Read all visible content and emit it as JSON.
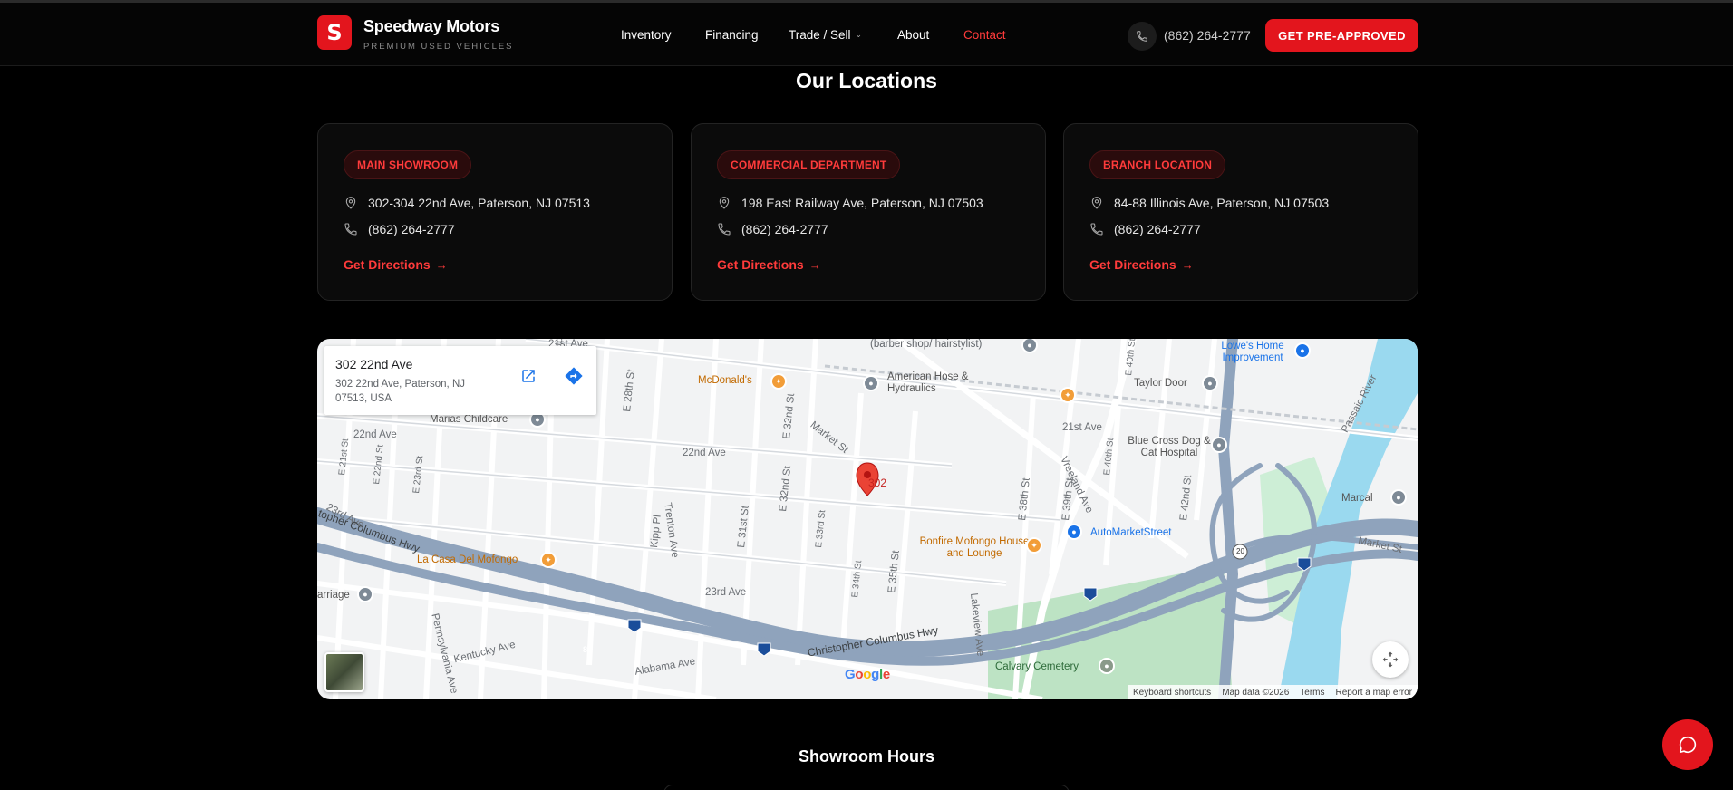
{
  "header": {
    "brand_name": "Speedway Motors",
    "brand_tagline": "PREMIUM USED VEHICLES",
    "logo_letter": "S",
    "nav": [
      {
        "label": "Inventory"
      },
      {
        "label": "Financing"
      },
      {
        "label": "Trade / Sell"
      },
      {
        "label": "About"
      },
      {
        "label": "Contact"
      }
    ],
    "phone": "(862) 264-2777",
    "cta_label": "GET PRE-APPROVED",
    "accent_color": "#e3151d"
  },
  "locations": {
    "title": "Our Locations",
    "cards": [
      {
        "badge": "MAIN SHOWROOM",
        "address": "302-304 22nd Ave, Paterson, NJ 07513",
        "phone": "(862) 264-2777",
        "directions": "Get Directions"
      },
      {
        "badge": "COMMERCIAL DEPARTMENT",
        "address": "198 East Railway Ave, Paterson, NJ 07503",
        "phone": "(862) 264-2777",
        "directions": "Get Directions"
      },
      {
        "badge": "BRANCH LOCATION",
        "address": "84-88 Illinois Ave, Paterson, NJ 07503",
        "phone": "(862) 264-2777",
        "directions": "Get Directions"
      }
    ]
  },
  "map": {
    "info_title": "302 22nd Ave",
    "info_address": "302 22nd Ave, Paterson, NJ 07513, USA",
    "pin_label": "302",
    "labels": {
      "barber": "(barber shop/ hairstylist)",
      "lowes": "Lowe's Home Improvement",
      "mcdonalds": "McDonald's",
      "american_hose": "American Hose & Hydraulics",
      "taylor_door": "Taylor Door",
      "marias": "Marias Childcare",
      "ave21": "21st Ave",
      "blue_cross": "Blue Cross Dog & Cat Hospital",
      "ave22a": "22nd Ave",
      "ave22b": "22nd Ave",
      "ave23a": "23rd Ave",
      "ave23b": "23rd Ave",
      "market_st": "Market St",
      "market_st2": "Market St",
      "marcal": "Marcal",
      "bonfire": "Bonfire Mofongo House and Lounge",
      "autostreet": "AutoMarketStreet",
      "la_casa": "La Casa Del Mofongo",
      "carriage": "arriage",
      "ccc_hwy": "topher Columbus Hwy",
      "ccc_hwy2": "Christopher Columbus Hwy",
      "kentucky": "Kentucky Ave",
      "alabama": "Alabama Ave",
      "calvary": "Calvary Cemetery",
      "passaic": "Passaic River",
      "trenton": "Trenton Ave",
      "trenton2": "Trenton Ave",
      "kipp": "Kipp Pl",
      "e31": "E 31st St",
      "e32": "E 32nd St",
      "e33": "E 33rd St",
      "e34": "E 34th St",
      "e35": "E 35th St",
      "e38": "E 38th St",
      "e39": "E 39th St",
      "e40": "E 40th St",
      "e42": "E 42nd St",
      "vreeland": "Vreeland Ave",
      "lakeview": "Lakeview Ave",
      "pennsylvania": "Pennsylvania Ave",
      "e28": "E 28th St",
      "e21": "E 21st St",
      "e22": "E 22nd St",
      "e23": "E 23rd St",
      "ave21b": "21st Ave",
      "i80": "80",
      "r20": "20"
    },
    "google": "Google",
    "attribution": [
      "Keyboard shortcuts",
      "Map data ©2026",
      "Terms",
      "Report a map error"
    ]
  },
  "hours": {
    "title": "Showroom Hours"
  }
}
